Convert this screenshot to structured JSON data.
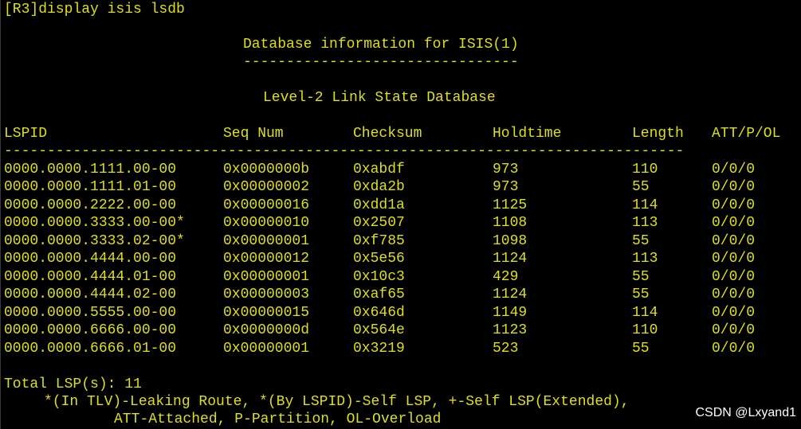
{
  "terminal": {
    "command": "[R3]display isis lsdb",
    "title": "Database information for ISIS(1)",
    "title_underline": "--------------------------------",
    "level_title": "Level-2 Link State Database",
    "headers": {
      "lspid": "LSPID",
      "seq": "Seq Num",
      "checksum": "Checksum",
      "holdtime": "Holdtime",
      "length": "Length",
      "attpol": "ATT/P/OL"
    },
    "separator": "-------------------------------------------------------------------------------",
    "rows": [
      {
        "lspid": "0000.0000.1111.00-00",
        "seq": "0x0000000b",
        "checksum": "0xabdf",
        "holdtime": "973",
        "length": "110",
        "attpol": "0/0/0"
      },
      {
        "lspid": "0000.0000.1111.01-00",
        "seq": "0x00000002",
        "checksum": "0xda2b",
        "holdtime": "973",
        "length": "55",
        "attpol": "0/0/0"
      },
      {
        "lspid": "0000.0000.2222.00-00",
        "seq": "0x00000016",
        "checksum": "0xdd1a",
        "holdtime": "1125",
        "length": "114",
        "attpol": "0/0/0"
      },
      {
        "lspid": "0000.0000.3333.00-00*",
        "seq": "0x00000010",
        "checksum": "0x2507",
        "holdtime": "1108",
        "length": "113",
        "attpol": "0/0/0"
      },
      {
        "lspid": "0000.0000.3333.02-00*",
        "seq": "0x00000001",
        "checksum": "0xf785",
        "holdtime": "1098",
        "length": "55",
        "attpol": "0/0/0"
      },
      {
        "lspid": "0000.0000.4444.00-00",
        "seq": "0x00000012",
        "checksum": "0x5e56",
        "holdtime": "1124",
        "length": "113",
        "attpol": "0/0/0"
      },
      {
        "lspid": "0000.0000.4444.01-00",
        "seq": "0x00000001",
        "checksum": "0x10c3",
        "holdtime": "429",
        "length": "55",
        "attpol": "0/0/0"
      },
      {
        "lspid": "0000.0000.4444.02-00",
        "seq": "0x00000003",
        "checksum": "0xaf65",
        "holdtime": "1124",
        "length": "55",
        "attpol": "0/0/0"
      },
      {
        "lspid": "0000.0000.5555.00-00",
        "seq": "0x00000015",
        "checksum": "0x646d",
        "holdtime": "1149",
        "length": "114",
        "attpol": "0/0/0"
      },
      {
        "lspid": "0000.0000.6666.00-00",
        "seq": "0x0000000d",
        "checksum": "0x564e",
        "holdtime": "1123",
        "length": "110",
        "attpol": "0/0/0"
      },
      {
        "lspid": "0000.0000.6666.01-00",
        "seq": "0x00000001",
        "checksum": "0x3219",
        "holdtime": "523",
        "length": "55",
        "attpol": "0/0/0"
      }
    ],
    "total": "Total LSP(s): 11",
    "legend_line1": "*(In TLV)-Leaking Route, *(By LSPID)-Self LSP, +-Self LSP(Extended),",
    "legend_line2": "ATT-Attached, P-Partition, OL-Overload"
  },
  "watermark": "CSDN @Lxyand1",
  "colors": {
    "background": "#000000",
    "text": "#dede22",
    "watermark": "#ffffff"
  }
}
